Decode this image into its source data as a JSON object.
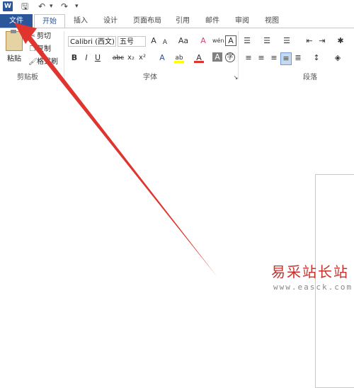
{
  "qat": {
    "logo": "W",
    "save": "🖫",
    "undo": "↶",
    "redo": "↷",
    "more": "▾"
  },
  "tabs": [
    "文件",
    "开始",
    "插入",
    "设计",
    "页面布局",
    "引用",
    "邮件",
    "审阅",
    "视图"
  ],
  "clipboard": {
    "paste": "粘贴",
    "cut": "剪切",
    "copy": "复制",
    "format_painter": "格式刷",
    "group": "剪贴板"
  },
  "font": {
    "name": "Calibri (西文)",
    "size": "五号",
    "grow": "A",
    "shrink": "A",
    "case": "Aa",
    "clear": "A",
    "phonetic": "wén",
    "border": "A",
    "bold": "B",
    "italic": "I",
    "underline": "U",
    "strike": "abc",
    "subscript": "x₂",
    "superscript": "x²",
    "effects": "A",
    "highlight": "ab",
    "color": "A",
    "shading": "A",
    "enclose": "字",
    "group": "字体"
  },
  "paragraph": {
    "group": "段落"
  },
  "watermark": {
    "cn": "易采站长站",
    "url": "www.easck.com"
  },
  "colors": {
    "accent": "#2b579a",
    "arrow": "#e0342f"
  }
}
